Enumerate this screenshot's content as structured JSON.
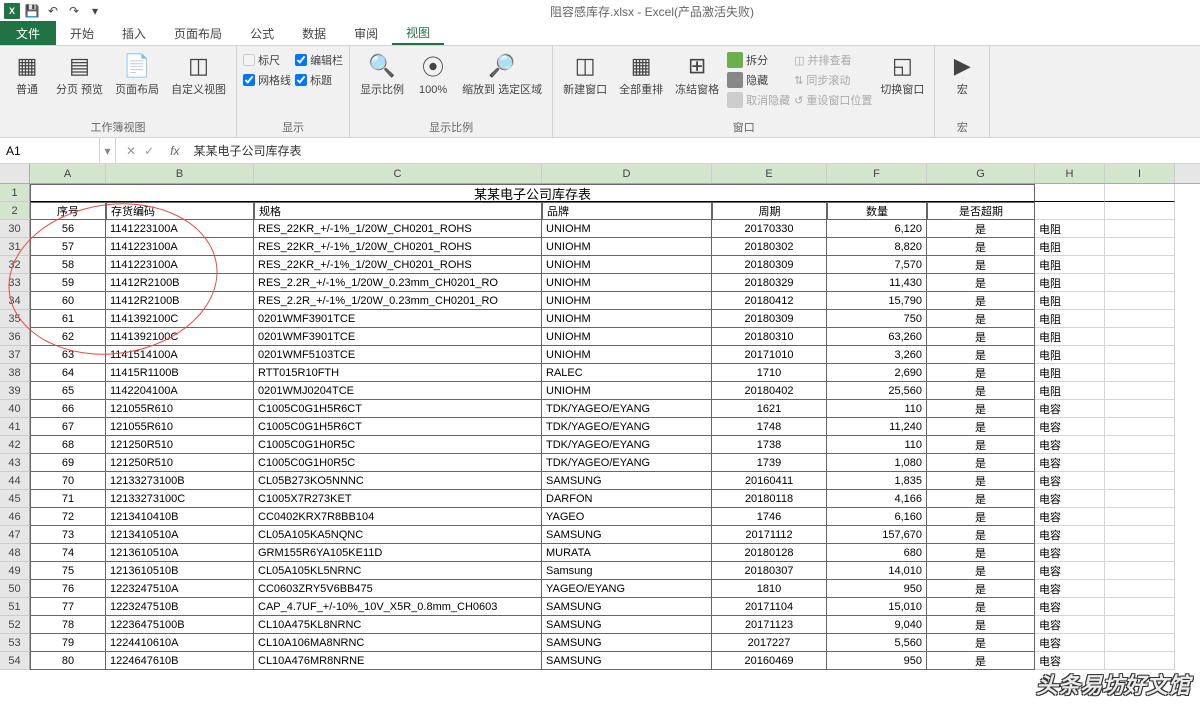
{
  "titlebar": {
    "title": "阻容感库存.xlsx - Excel(产品激活失败)"
  },
  "tabs": {
    "file": "文件",
    "items": [
      "开始",
      "插入",
      "页面布局",
      "公式",
      "数据",
      "审阅",
      "视图"
    ],
    "active": 6
  },
  "ribbon": {
    "group1": {
      "label": "工作簿视图",
      "btns": [
        "普通",
        "分页\n预览",
        "页面布局",
        "自定义视图"
      ]
    },
    "group2": {
      "label": "显示",
      "chks": [
        [
          "标尺",
          false
        ],
        [
          "编辑栏",
          true
        ],
        [
          "网格线",
          true
        ],
        [
          "标题",
          true
        ]
      ]
    },
    "group3": {
      "label": "显示比例",
      "btns": [
        "显示比例",
        "100%",
        "缩放到\n选定区域"
      ]
    },
    "group4": {
      "label": "窗口",
      "btns": [
        "新建窗口",
        "全部重排",
        "冻结窗格"
      ],
      "side": [
        "拆分",
        "隐藏",
        "取消隐藏"
      ],
      "side2": [
        "并排查看",
        "同步滚动",
        "重设窗口位置"
      ],
      "switch": "切换窗口"
    },
    "group5": {
      "label": "宏",
      "btn": "宏"
    }
  },
  "formulaBar": {
    "cellRef": "A1",
    "formula": "某某电子公司库存表"
  },
  "columns": [
    "A",
    "B",
    "C",
    "D",
    "E",
    "F",
    "G",
    "H",
    "I"
  ],
  "titleRow": {
    "rownum": "1",
    "text": "某某电子公司库存表"
  },
  "headerRow": {
    "rownum": "2",
    "cells": [
      "序号",
      "存货编码",
      "规格",
      "品牌",
      "周期",
      "数量",
      "是否超期",
      ""
    ]
  },
  "rows": [
    {
      "n": "30",
      "d": [
        "56",
        "1141223100A",
        "RES_22KR_+/-1%_1/20W_CH0201_ROHS",
        "UNIOHM",
        "20170330",
        "6,120",
        "是",
        "电阻"
      ]
    },
    {
      "n": "31",
      "d": [
        "57",
        "1141223100A",
        "RES_22KR_+/-1%_1/20W_CH0201_ROHS",
        "UNIOHM",
        "20180302",
        "8,820",
        "是",
        "电阻"
      ]
    },
    {
      "n": "32",
      "d": [
        "58",
        "1141223100A",
        "RES_22KR_+/-1%_1/20W_CH0201_ROHS",
        "UNIOHM",
        "20180309",
        "7,570",
        "是",
        "电阻"
      ]
    },
    {
      "n": "33",
      "d": [
        "59",
        "11412R2100B",
        "RES_2.2R_+/-1%_1/20W_0.23mm_CH0201_RO",
        "UNIOHM",
        "20180329",
        "11,430",
        "是",
        "电阻"
      ]
    },
    {
      "n": "34",
      "d": [
        "60",
        "11412R2100B",
        "RES_2.2R_+/-1%_1/20W_0.23mm_CH0201_RO",
        "UNIOHM",
        "20180412",
        "15,790",
        "是",
        "电阻"
      ]
    },
    {
      "n": "35",
      "d": [
        "61",
        "1141392100C",
        "0201WMF3901TCE",
        "UNIOHM",
        "20180309",
        "750",
        "是",
        "电阻"
      ]
    },
    {
      "n": "36",
      "d": [
        "62",
        "1141392100C",
        "0201WMF3901TCE",
        "UNIOHM",
        "20180310",
        "63,260",
        "是",
        "电阻"
      ]
    },
    {
      "n": "37",
      "d": [
        "63",
        "1141514100A",
        "0201WMF5103TCE",
        "UNIOHM",
        "20171010",
        "3,260",
        "是",
        "电阻"
      ]
    },
    {
      "n": "38",
      "d": [
        "64",
        "11415R1100B",
        "RTT015R10FTH",
        "RALEC",
        "1710",
        "2,690",
        "是",
        "电阻"
      ]
    },
    {
      "n": "39",
      "d": [
        "65",
        "1142204100A",
        "0201WMJ0204TCE",
        "UNIOHM",
        "20180402",
        "25,560",
        "是",
        "电阻"
      ]
    },
    {
      "n": "40",
      "d": [
        "66",
        "121055R610",
        "C1005C0G1H5R6CT",
        "TDK/YAGEO/EYANG",
        "1621",
        "110",
        "是",
        "电容"
      ]
    },
    {
      "n": "41",
      "d": [
        "67",
        "121055R610",
        "C1005C0G1H5R6CT",
        "TDK/YAGEO/EYANG",
        "1748",
        "11,240",
        "是",
        "电容"
      ]
    },
    {
      "n": "42",
      "d": [
        "68",
        "121250R510",
        "C1005C0G1H0R5C",
        "TDK/YAGEO/EYANG",
        "1738",
        "110",
        "是",
        "电容"
      ]
    },
    {
      "n": "43",
      "d": [
        "69",
        "121250R510",
        "C1005C0G1H0R5C",
        "TDK/YAGEO/EYANG",
        "1739",
        "1,080",
        "是",
        "电容"
      ]
    },
    {
      "n": "44",
      "d": [
        "70",
        "12133273100B",
        "CL05B273KO5NNNC",
        "SAMSUNG",
        "20160411",
        "1,835",
        "是",
        "电容"
      ]
    },
    {
      "n": "45",
      "d": [
        "71",
        "12133273100C",
        "C1005X7R273KET",
        "DARFON",
        "20180118",
        "4,166",
        "是",
        "电容"
      ]
    },
    {
      "n": "46",
      "d": [
        "72",
        "1213410410B",
        "CC0402KRX7R8BB104",
        "YAGEO",
        "1746",
        "6,160",
        "是",
        "电容"
      ]
    },
    {
      "n": "47",
      "d": [
        "73",
        "1213410510A",
        "CL05A105KA5NQNC",
        "SAMSUNG",
        "20171112",
        "157,670",
        "是",
        "电容"
      ]
    },
    {
      "n": "48",
      "d": [
        "74",
        "1213610510A",
        "GRM155R6YA105KE11D",
        "MURATA",
        "20180128",
        "680",
        "是",
        "电容"
      ]
    },
    {
      "n": "49",
      "d": [
        "75",
        "1213610510B",
        "CL05A105KL5NRNC",
        "Samsung",
        "20180307",
        "14,010",
        "是",
        "电容"
      ]
    },
    {
      "n": "50",
      "d": [
        "76",
        "1223247510A",
        "CC0603ZRY5V6BB475",
        "YAGEO/EYANG",
        "1810",
        "950",
        "是",
        "电容"
      ]
    },
    {
      "n": "51",
      "d": [
        "77",
        "1223247510B",
        "CAP_4.7UF_+/-10%_10V_X5R_0.8mm_CH0603",
        "SAMSUNG",
        "20171104",
        "15,010",
        "是",
        "电容"
      ]
    },
    {
      "n": "52",
      "d": [
        "78",
        "12236475100B",
        "CL10A475KL8NRNC",
        "SAMSUNG",
        "20171123",
        "9,040",
        "是",
        "电容"
      ]
    },
    {
      "n": "53",
      "d": [
        "79",
        "1224410610A",
        "CL10A106MA8NRNC",
        "SAMSUNG",
        "2017227",
        "5,560",
        "是",
        "电容"
      ]
    },
    {
      "n": "54",
      "d": [
        "80",
        "1224647610B",
        "CL10A476MR8NRNE",
        "SAMSUNG",
        "20160469",
        "950",
        "是",
        "电容"
      ]
    }
  ],
  "watermark": "头条易坊好文馆"
}
